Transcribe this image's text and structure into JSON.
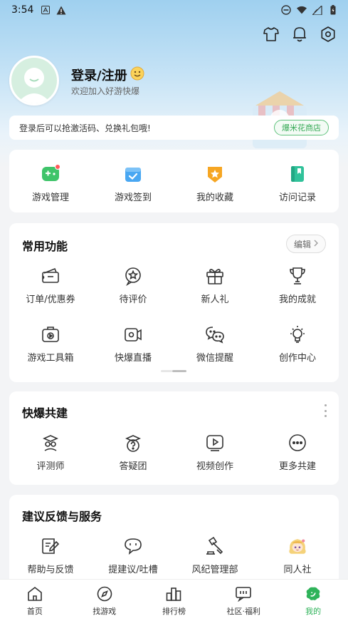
{
  "status_bar": {
    "time": "3:54",
    "left_icons": [
      "app-notification-icon",
      "alert-icon"
    ],
    "right_icons": [
      "dnd-icon",
      "wifi-icon",
      "cellular-icon",
      "battery-icon"
    ]
  },
  "top_actions": [
    "shirt-icon",
    "bell-icon",
    "settings-icon"
  ],
  "profile": {
    "title": "登录/注册",
    "subtitle": "欢迎加入好游快爆"
  },
  "promo": {
    "text": "登录后可以抢激活码、兑换礼包哦!",
    "button": "爆米花商店"
  },
  "quick_links": [
    {
      "label": "游戏管理",
      "icon": "gamepad-icon"
    },
    {
      "label": "游戏签到",
      "icon": "calendar-check-icon"
    },
    {
      "label": "我的收藏",
      "icon": "star-badge-icon"
    },
    {
      "label": "访问记录",
      "icon": "bookmark-book-icon"
    }
  ],
  "common_functions": {
    "title": "常用功能",
    "edit_label": "编辑",
    "items": [
      {
        "label": "订单/优惠券",
        "icon": "coupon-icon"
      },
      {
        "label": "待评价",
        "icon": "review-star-icon"
      },
      {
        "label": "新人礼",
        "icon": "gift-icon"
      },
      {
        "label": "我的成就",
        "icon": "trophy-icon"
      },
      {
        "label": "游戏工具箱",
        "icon": "toolbox-icon"
      },
      {
        "label": "快爆直播",
        "icon": "video-camera-icon"
      },
      {
        "label": "微信提醒",
        "icon": "wechat-icon"
      },
      {
        "label": "创作中心",
        "icon": "lightbulb-icon"
      }
    ]
  },
  "co_build": {
    "title": "快爆共建",
    "items": [
      {
        "label": "评测师",
        "icon": "reviewer-icon"
      },
      {
        "label": "答疑团",
        "icon": "question-icon"
      },
      {
        "label": "视频创作",
        "icon": "play-video-icon"
      },
      {
        "label": "更多共建",
        "icon": "more-dots-icon"
      }
    ]
  },
  "feedback": {
    "title": "建议反馈与服务",
    "items": [
      {
        "label": "帮助与反馈",
        "icon": "help-edit-icon"
      },
      {
        "label": "提建议/吐槽",
        "icon": "chat-bubble-icon"
      },
      {
        "label": "风纪管理部",
        "icon": "gavel-icon"
      },
      {
        "label": "同人社",
        "icon": "anime-avatar-icon"
      }
    ]
  },
  "bottom_nav": [
    {
      "label": "首页",
      "icon": "home-icon",
      "active": false
    },
    {
      "label": "找游戏",
      "icon": "compass-icon",
      "active": false
    },
    {
      "label": "排行榜",
      "icon": "ranking-icon",
      "active": false
    },
    {
      "label": "社区·福利",
      "icon": "community-icon",
      "active": false
    },
    {
      "label": "我的",
      "icon": "me-icon",
      "active": true
    }
  ],
  "colors": {
    "accent_green": "#2fb35a",
    "page_bg": "#f3f4f6"
  }
}
